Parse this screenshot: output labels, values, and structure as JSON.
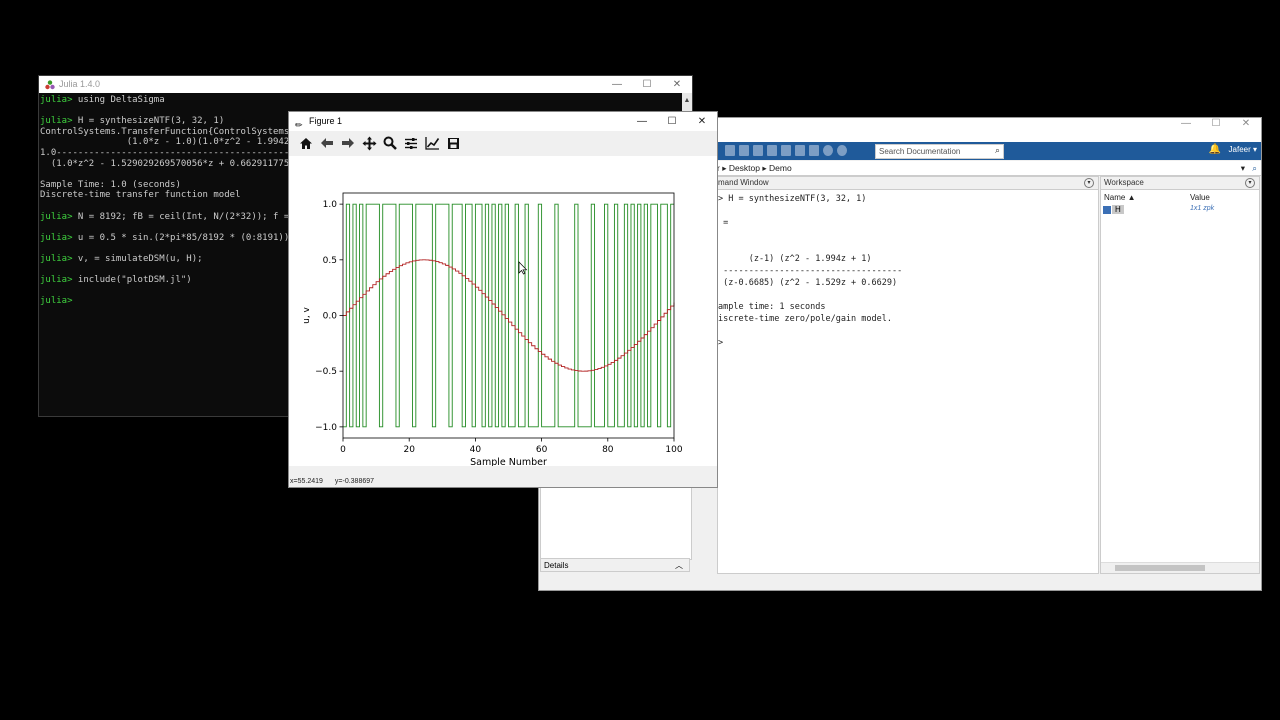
{
  "julia": {
    "title": "Julia 1.4.0",
    "lines": [
      {
        "prompt": "julia>",
        "text": " using DeltaSigma"
      },
      {
        "prompt": "",
        "text": ""
      },
      {
        "prompt": "julia>",
        "text": " H = synthesizeNTF(3, 32, 1)"
      },
      {
        "prompt": "",
        "text": "ControlSystems.TransferFunction{ControlSystems."
      },
      {
        "prompt": "",
        "text": "                (1.0*z - 1.0)(1.0*z^2 - 1.9942"
      },
      {
        "prompt": "",
        "text": "1.0-------------------------------------------"
      },
      {
        "prompt": "",
        "text": "  (1.0*z^2 - 1.529029269570056*z + 0.662911775"
      },
      {
        "prompt": "",
        "text": ""
      },
      {
        "prompt": "",
        "text": "Sample Time: 1.0 (seconds)"
      },
      {
        "prompt": "",
        "text": "Discrete-time transfer function model"
      },
      {
        "prompt": "",
        "text": ""
      },
      {
        "prompt": "julia>",
        "text": " N = 8192; fB = ceil(Int, N/(2*32)); f ="
      },
      {
        "prompt": "",
        "text": ""
      },
      {
        "prompt": "julia>",
        "text": " u = 0.5 * sin.(2*pi*85/8192 * (0:8191));"
      },
      {
        "prompt": "",
        "text": ""
      },
      {
        "prompt": "julia>",
        "text": " v, = simulateDSM(u, H);"
      },
      {
        "prompt": "",
        "text": ""
      },
      {
        "prompt": "julia>",
        "text": " include(\"plotDSM.jl\")"
      },
      {
        "prompt": "",
        "text": ""
      },
      {
        "prompt": "julia>",
        "text": ""
      }
    ]
  },
  "figure": {
    "title": "Figure 1",
    "status_x": "x=55.2419",
    "status_y": "y=-0.388697",
    "toolbar": [
      "home-icon",
      "back-arrow-icon",
      "forward-arrow-icon",
      "pan-icon",
      "zoom-icon",
      "configure-subplots-icon",
      "edit-axis-icon",
      "save-icon"
    ]
  },
  "matlab": {
    "path": "r  ▸  Desktop  ▸  Demo",
    "search_placeholder": "Search Documentation",
    "user": "Jafeer ▾",
    "cmd_title": "mand Window",
    "cmd_lines": [
      "> H = synthesizeNTF(3, 32, 1)",
      "",
      " =",
      "",
      "",
      "      (z-1) (z^2 - 1.994z + 1)",
      " -----------------------------------",
      " (z-0.6685) (z^2 - 1.529z + 0.6629)",
      "",
      "ample time: 1 seconds",
      "iscrete-time zero/pole/gain model.",
      "",
      ">"
    ],
    "workspace_title": "Workspace",
    "ws_col_name": "Name ▲",
    "ws_col_value": "Value",
    "ws_var_name": "H",
    "ws_var_value": "1x1 zpk",
    "details_label": "Details"
  },
  "chart_data": {
    "type": "line",
    "title": "",
    "xlabel": "Sample Number",
    "ylabel": "u, v",
    "xlim": [
      0,
      100
    ],
    "ylim": [
      -1.1,
      1.1
    ],
    "xticks": [
      0,
      20,
      40,
      60,
      80,
      100
    ],
    "yticks": [
      1.0,
      0.5,
      0.0,
      -0.5,
      -1.0
    ],
    "xtick_labels": [
      "0",
      "20",
      "40",
      "60",
      "80",
      "100"
    ],
    "ytick_labels": [
      "1.0",
      "0.5",
      "0.0",
      "−0.5",
      "−1.0"
    ],
    "series": [
      {
        "name": "",
        "color": "#228b22",
        "style": "step",
        "values": [
          -1,
          1,
          -1,
          1,
          -1,
          1,
          -1,
          1,
          1,
          1,
          1,
          -1,
          1,
          1,
          1,
          1,
          -1,
          1,
          1,
          1,
          1,
          -1,
          1,
          1,
          1,
          1,
          1,
          -1,
          1,
          1,
          1,
          1,
          -1,
          1,
          1,
          1,
          -1,
          1,
          1,
          -1,
          1,
          1,
          -1,
          1,
          -1,
          1,
          -1,
          1,
          -1,
          1,
          -1,
          -1,
          1,
          -1,
          -1,
          1,
          -1,
          -1,
          -1,
          1,
          -1,
          -1,
          -1,
          -1,
          1,
          -1,
          -1,
          -1,
          -1,
          -1,
          1,
          -1,
          -1,
          -1,
          -1,
          1,
          -1,
          -1,
          -1,
          1,
          -1,
          -1,
          1,
          -1,
          -1,
          1,
          -1,
          1,
          -1,
          1,
          -1,
          1,
          -1,
          1,
          1,
          -1,
          1,
          1,
          -1,
          1
        ]
      },
      {
        "name": "",
        "color": "#b22222",
        "style": "step",
        "function": "0.5*sin(2*pi*85/8192*n)"
      }
    ]
  }
}
